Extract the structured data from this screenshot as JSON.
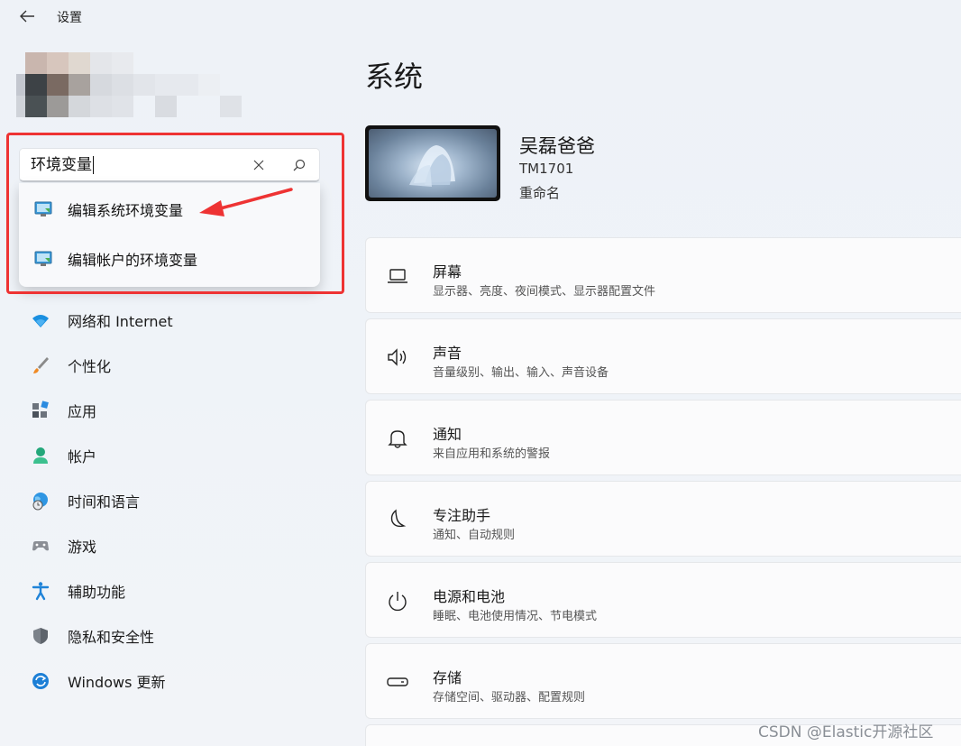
{
  "app": {
    "title": "设置"
  },
  "search": {
    "value": "环境变量",
    "results": [
      {
        "label": "编辑系统环境变量",
        "icon": "system-properties-icon"
      },
      {
        "label": "编辑帐户的环境变量",
        "icon": "system-properties-icon"
      }
    ]
  },
  "sidebar": {
    "items": [
      {
        "label": "网络和 Internet",
        "icon": "wifi-icon"
      },
      {
        "label": "个性化",
        "icon": "brush-icon"
      },
      {
        "label": "应用",
        "icon": "apps-icon"
      },
      {
        "label": "帐户",
        "icon": "person-icon"
      },
      {
        "label": "时间和语言",
        "icon": "globe-clock-icon"
      },
      {
        "label": "游戏",
        "icon": "gamepad-icon"
      },
      {
        "label": "辅助功能",
        "icon": "accessibility-icon"
      },
      {
        "label": "隐私和安全性",
        "icon": "shield-icon"
      },
      {
        "label": "Windows 更新",
        "icon": "sync-icon"
      }
    ]
  },
  "main": {
    "title": "系统",
    "device": {
      "name": "吴磊爸爸",
      "model": "TM1701",
      "rename": "重命名"
    },
    "cards": [
      {
        "title": "屏幕",
        "subtitle": "显示器、亮度、夜间模式、显示器配置文件",
        "icon": "laptop-icon"
      },
      {
        "title": "声音",
        "subtitle": "音量级别、输出、输入、声音设备",
        "icon": "speaker-icon"
      },
      {
        "title": "通知",
        "subtitle": "来自应用和系统的警报",
        "icon": "bell-icon"
      },
      {
        "title": "专注助手",
        "subtitle": "通知、自动规则",
        "icon": "moon-icon"
      },
      {
        "title": "电源和电池",
        "subtitle": "睡眠、电池使用情况、节电模式",
        "icon": "power-icon"
      },
      {
        "title": "存储",
        "subtitle": "存储空间、驱动器、配置规则",
        "icon": "drive-icon"
      }
    ]
  },
  "watermark": "CSDN @Elastic开源社区",
  "colors": {
    "annotation": "#e33333",
    "accent": "#0067c0"
  }
}
